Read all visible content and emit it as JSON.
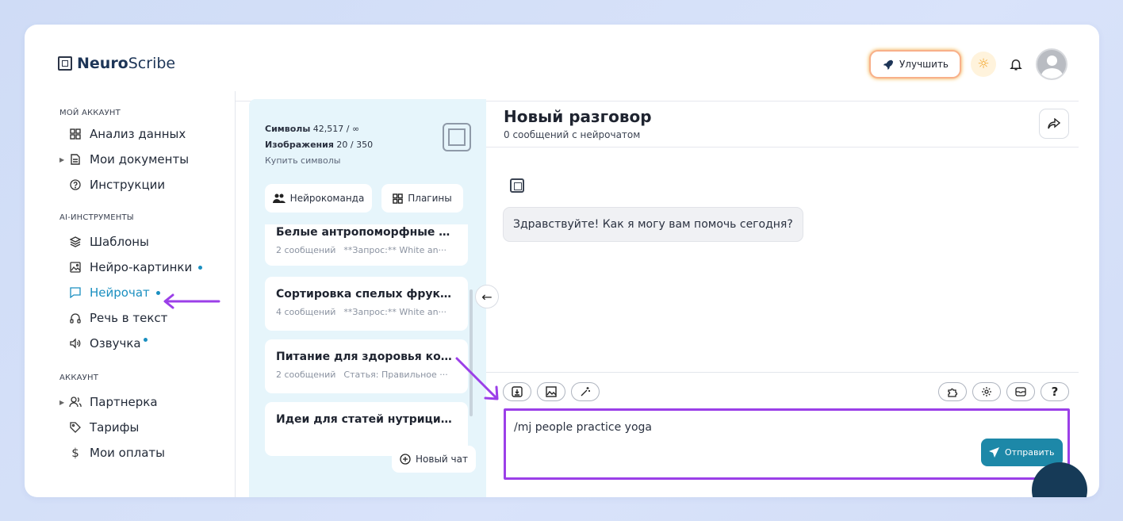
{
  "app": {
    "brand_bold": "Neuro",
    "brand_rest": "Scribe"
  },
  "header": {
    "upgrade_label": "Улучшить"
  },
  "sidebar": {
    "sections": [
      {
        "label": "МОЙ АККАУНТ"
      },
      {
        "label": "AI-ИНСТРУМЕНТЫ"
      },
      {
        "label": "АККАУНТ"
      }
    ],
    "items": [
      {
        "label": "Анализ данных",
        "icon": "grid-icon"
      },
      {
        "label": "Мои документы",
        "icon": "document-icon"
      },
      {
        "label": "Инструкции",
        "icon": "help-circle-icon"
      },
      {
        "label": "Шаблоны",
        "icon": "layers-icon"
      },
      {
        "label": "Нейро-картинки",
        "icon": "image-icon"
      },
      {
        "label": "Нейрочат",
        "icon": "chat-icon"
      },
      {
        "label": "Речь в текст",
        "icon": "headphones-icon"
      },
      {
        "label": "Озвучка",
        "icon": "speaker-icon"
      },
      {
        "label": "Партнерка",
        "icon": "users-icon"
      },
      {
        "label": "Тарифы",
        "icon": "tag-icon"
      },
      {
        "label": "Мои оплаты",
        "icon": "dollar-icon"
      }
    ]
  },
  "panel": {
    "symbols_label": "Символы",
    "symbols_value": "42,517 / ∞",
    "images_label": "Изображения",
    "images_value": "20 / 350",
    "buy_label": "Купить символы",
    "team_button": "Нейрокоманда",
    "plugins_button": "Плагины",
    "new_chat_button": "Новый чат",
    "chats": [
      {
        "title": "Белые антропоморфные к···",
        "count": "2 сообщений",
        "preview": "**Запрос:** White an···"
      },
      {
        "title": "Сортировка спелых фрукт···",
        "count": "4 сообщений",
        "preview": "**Запрос:** White an···"
      },
      {
        "title": "Питание для здоровья кожи",
        "count": "2 сообщений",
        "preview": "Статья: Правильное ···"
      },
      {
        "title": "Идеи для статей нутрицио···",
        "count": "",
        "preview": ""
      }
    ]
  },
  "conversation": {
    "title": "Новый разговор",
    "subtitle": "0 сообщений с нейрочатом",
    "greeting": "Здравствуйте! Как я могу вам помочь сегодня?",
    "input_value": "/mj people practice yoga",
    "send_label": "Отправить",
    "help_label": "?"
  },
  "colors": {
    "accent": "#1a8fc0",
    "highlight": "#9b3fe8",
    "send": "#1d88a8"
  }
}
